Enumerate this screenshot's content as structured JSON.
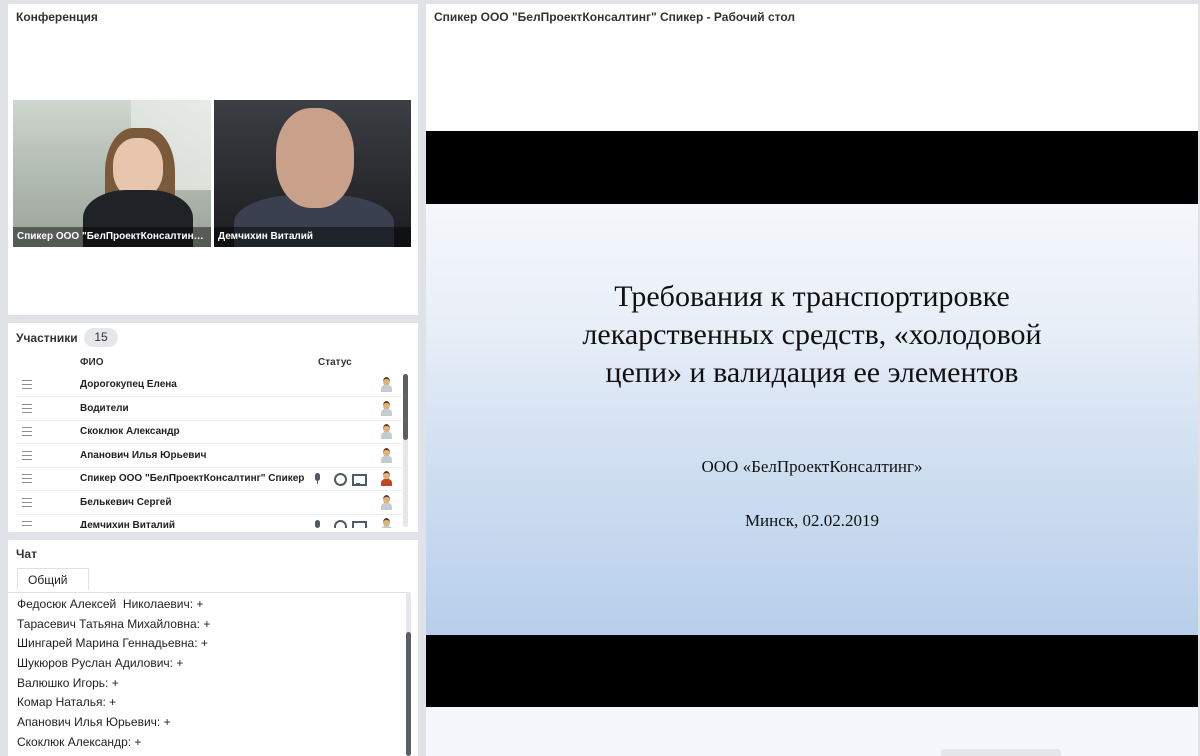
{
  "conference": {
    "title": "Конференция",
    "videos": [
      {
        "caption": "Спикер ООО \"БелПроектКонсалтинг\" Спикер"
      },
      {
        "caption": "Демчихин Виталий"
      }
    ]
  },
  "participants": {
    "title": "Участники",
    "count": "15",
    "col_name": "ФИО",
    "col_status": "Статус",
    "rows": [
      {
        "name": "Дорогокупец Елена"
      },
      {
        "name": "Водители"
      },
      {
        "name": "Скоклюк Александр"
      },
      {
        "name": "Апанович Илья Юрьевич"
      },
      {
        "name": "Спикер ООО \"БелПроектКонсалтинг\" Спикер"
      },
      {
        "name": "Белькевич Сергей"
      },
      {
        "name": "Демчихин Виталий"
      }
    ]
  },
  "chat": {
    "title": "Чат",
    "tab": "Общий",
    "messages": [
      "Федосюк Алексей  Николаевич: +",
      "Тарасевич Татьяна Михайловна: +",
      "Шингарей Марина Геннадьевна: +",
      "Шукюров Руслан Адилович: +",
      "Валюшко Игорь: +",
      "Комар Наталья: +",
      "Апанович Илья Юрьевич: +",
      "Скоклюк Александр: +"
    ]
  },
  "share": {
    "title": "Спикер ООО \"БелПроектКонсалтинг\" Спикер - Рабочий стол",
    "slide": {
      "title_line1": "Требования к транспортировке",
      "title_line2": "лекарственных средств, «холодовой",
      "title_line3": "цепи» и валидация ее элементов",
      "org": "ООО «БелПроектКонсалтинг»",
      "date": "Минск, 02.02.2019"
    }
  },
  "colors": {
    "page_bg": "#dfe2e6",
    "panel_bg": "#ffffff",
    "active_user": "#c0471f"
  }
}
